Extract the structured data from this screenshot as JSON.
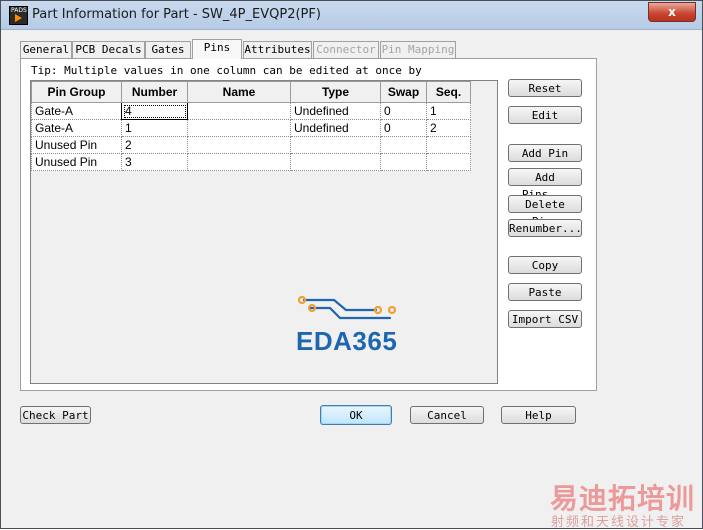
{
  "window": {
    "title": "Part Information for Part - SW_4P_EVQP2(PF)",
    "app_icon_label": "PADS",
    "close_glyph": "x"
  },
  "tabs": [
    {
      "label": "General",
      "state": "normal"
    },
    {
      "label": "PCB Decals",
      "state": "normal"
    },
    {
      "label": "Gates",
      "state": "normal"
    },
    {
      "label": "Pins",
      "state": "active"
    },
    {
      "label": "Attributes",
      "state": "normal"
    },
    {
      "label": "Connector",
      "state": "disabled"
    },
    {
      "label": "Pin Mapping",
      "state": "disabled"
    }
  ],
  "tip": "Tip: Multiple values in one column can be edited at once by",
  "grid": {
    "columns": [
      "Pin Group",
      "Number",
      "Name",
      "Type",
      "Swap",
      "Seq."
    ],
    "rows": [
      [
        "Gate-A",
        "4",
        "",
        "Undefined",
        "0",
        "1"
      ],
      [
        "Gate-A",
        "1",
        "",
        "Undefined",
        "0",
        "2"
      ],
      [
        "Unused Pin",
        "2",
        "",
        "",
        "",
        ""
      ],
      [
        "Unused Pin",
        "3",
        "",
        "",
        "",
        ""
      ]
    ]
  },
  "logo": {
    "text": "EDA365",
    "color": "#1f66b1",
    "accent": "#f0a030"
  },
  "side_buttons": {
    "reset": "Reset",
    "edit": "Edit",
    "add_pin": "Add Pin",
    "add_pins": "Add Pins...",
    "delete_pins": "Delete Pins",
    "renumber": "Renumber...",
    "copy": "Copy",
    "paste": "Paste",
    "import_csv": "Import CSV"
  },
  "bottom_buttons": {
    "check_part": "Check Part",
    "ok": "OK",
    "cancel": "Cancel",
    "help": "Help"
  },
  "watermark": {
    "line1": "易迪拓培训",
    "line2": "射频和天线设计专家"
  }
}
